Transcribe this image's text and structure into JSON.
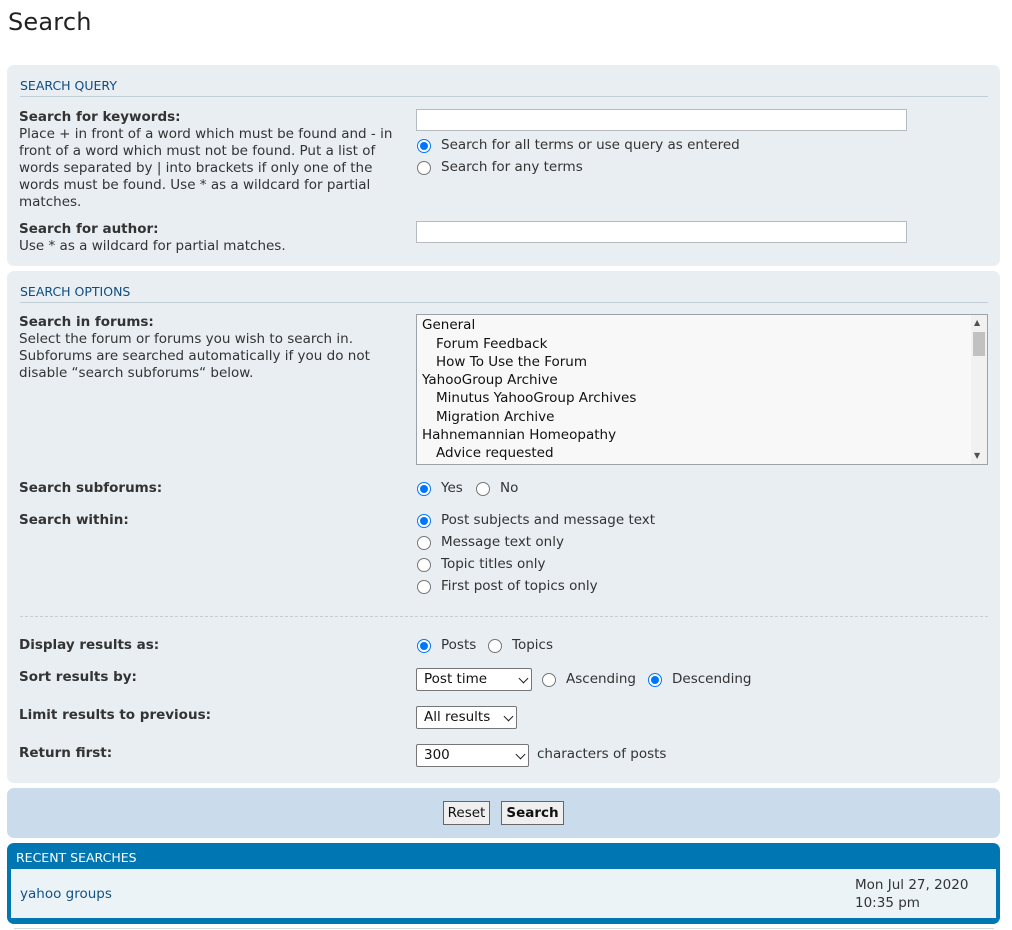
{
  "page_title": "Search",
  "colors": {
    "panel": "#e8eef2",
    "heading": "#0e4c80",
    "accent": "#0076b3",
    "radio_checked": "#0075ff",
    "link": "#105289"
  },
  "query": {
    "heading": "SEARCH QUERY",
    "keywords_label": "Search for keywords:",
    "keywords_desc": [
      "Place + in front of a word which must be found and - in",
      "front of a word which must not be found. Put a list of",
      "words separated by | into brackets if only one of the",
      "words must be found. Use * as a wildcard for partial",
      "matches."
    ],
    "keywords_value": "",
    "terms_options": [
      "Search for all terms or use query as entered",
      "Search for any terms"
    ],
    "terms_selected": 0,
    "author_label": "Search for author:",
    "author_desc": "Use * as a wildcard for partial matches.",
    "author_value": ""
  },
  "options": {
    "heading": "SEARCH OPTIONS",
    "forums_label": "Search in forums:",
    "forums_desc": [
      "Select the forum or forums you wish to search in.",
      "Subforums are searched automatically if you do not",
      "disable “search subforums“ below."
    ],
    "forums": [
      {
        "name": "General",
        "sub": false
      },
      {
        "name": "Forum Feedback",
        "sub": true
      },
      {
        "name": "How To Use the Forum",
        "sub": true
      },
      {
        "name": "YahooGroup Archive",
        "sub": false
      },
      {
        "name": "Minutus YahooGroup Archives",
        "sub": true
      },
      {
        "name": "Migration Archive",
        "sub": true
      },
      {
        "name": "Hahnemannian Homeopathy",
        "sub": false
      },
      {
        "name": "Advice requested",
        "sub": true
      }
    ],
    "subforums_label": "Search subforums:",
    "subforums_yes": "Yes",
    "subforums_no": "No",
    "within_label": "Search within:",
    "within_options": [
      "Post subjects and message text",
      "Message text only",
      "Topic titles only",
      "First post of topics only"
    ],
    "within_selected": 0,
    "display_label": "Display results as:",
    "display_posts": "Posts",
    "display_topics": "Topics",
    "sort_label": "Sort results by:",
    "sort_value": "Post time",
    "sort_ascending": "Ascending",
    "sort_descending": "Descending",
    "limit_label": "Limit results to previous:",
    "limit_value": "All results",
    "return_label": "Return first:",
    "return_value": "300",
    "return_suffix": "characters of posts"
  },
  "buttons": {
    "reset": "Reset",
    "search": "Search"
  },
  "recent": {
    "heading": "RECENT SEARCHES",
    "items": [
      {
        "query": "yahoo groups",
        "date": "Mon Jul 27, 2020",
        "time": "10:35 pm"
      }
    ]
  }
}
